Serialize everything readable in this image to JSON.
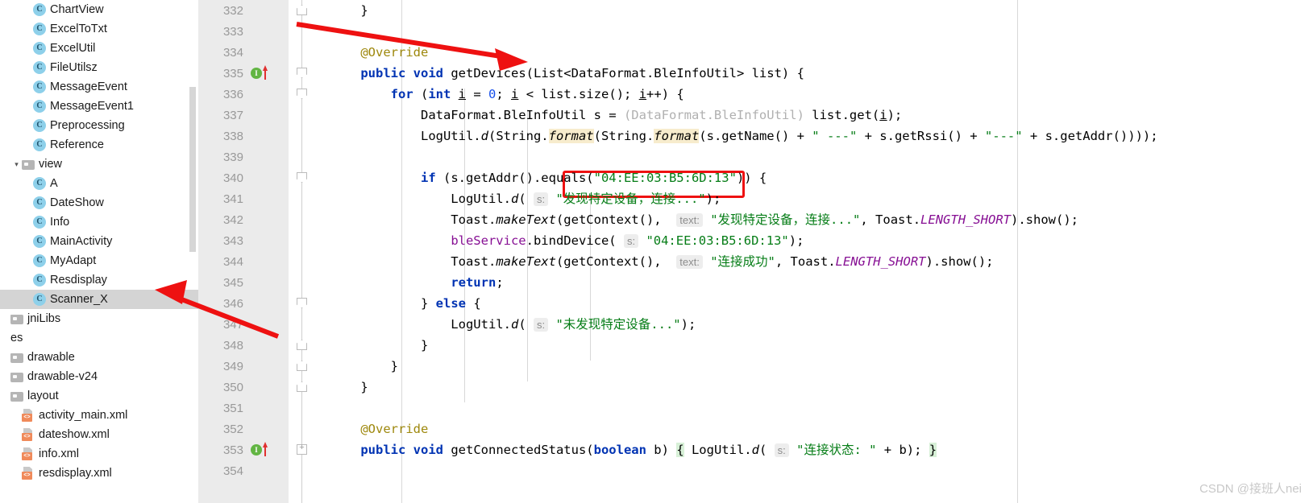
{
  "sidebar": {
    "items": [
      {
        "indent": 2,
        "icon": "java-class-icon",
        "label": "ChartView",
        "selected": false,
        "expander": ""
      },
      {
        "indent": 2,
        "icon": "java-class-icon",
        "label": "ExcelToTxt",
        "selected": false,
        "expander": ""
      },
      {
        "indent": 2,
        "icon": "java-class-icon",
        "label": "ExcelUtil",
        "selected": false,
        "expander": ""
      },
      {
        "indent": 2,
        "icon": "java-class-icon",
        "label": "FileUtilsz",
        "selected": false,
        "expander": ""
      },
      {
        "indent": 2,
        "icon": "java-class-icon",
        "label": "MessageEvent",
        "selected": false,
        "expander": ""
      },
      {
        "indent": 2,
        "icon": "java-class-icon",
        "label": "MessageEvent1",
        "selected": false,
        "expander": ""
      },
      {
        "indent": 2,
        "icon": "java-class-icon",
        "label": "Preprocessing",
        "selected": false,
        "expander": ""
      },
      {
        "indent": 2,
        "icon": "java-class-icon",
        "label": "Reference",
        "selected": false,
        "expander": ""
      },
      {
        "indent": 1,
        "icon": "folder-icon",
        "label": "view",
        "selected": false,
        "expander": "▾"
      },
      {
        "indent": 2,
        "icon": "java-class-icon",
        "label": "A",
        "selected": false,
        "expander": ""
      },
      {
        "indent": 2,
        "icon": "java-class-icon",
        "label": "DateShow",
        "selected": false,
        "expander": ""
      },
      {
        "indent": 2,
        "icon": "java-class-icon",
        "label": "Info",
        "selected": false,
        "expander": ""
      },
      {
        "indent": 2,
        "icon": "java-class-icon",
        "label": "MainActivity",
        "selected": false,
        "expander": ""
      },
      {
        "indent": 2,
        "icon": "java-class-icon",
        "label": "MyAdapt",
        "selected": false,
        "expander": ""
      },
      {
        "indent": 2,
        "icon": "java-class-icon",
        "label": "Resdisplay",
        "selected": false,
        "expander": ""
      },
      {
        "indent": 2,
        "icon": "java-class-icon",
        "label": "Scanner_X",
        "selected": true,
        "expander": ""
      },
      {
        "indent": 0,
        "icon": "folder-icon",
        "label": "jniLibs",
        "selected": false,
        "expander": ""
      },
      {
        "indent": 0,
        "icon": "none",
        "label": "es",
        "selected": false,
        "expander": ""
      },
      {
        "indent": 0,
        "icon": "folder-icon",
        "label": "drawable",
        "selected": false,
        "expander": ""
      },
      {
        "indent": 0,
        "icon": "folder-icon",
        "label": "drawable-v24",
        "selected": false,
        "expander": ""
      },
      {
        "indent": 0,
        "icon": "folder-icon",
        "label": "layout",
        "selected": false,
        "expander": ""
      },
      {
        "indent": 1,
        "icon": "xml-file-icon",
        "label": "activity_main.xml",
        "selected": false,
        "expander": ""
      },
      {
        "indent": 1,
        "icon": "xml-file-icon",
        "label": "dateshow.xml",
        "selected": false,
        "expander": ""
      },
      {
        "indent": 1,
        "icon": "xml-file-icon",
        "label": "info.xml",
        "selected": false,
        "expander": ""
      },
      {
        "indent": 1,
        "icon": "xml-file-icon",
        "label": "resdisplay.xml",
        "selected": false,
        "expander": ""
      }
    ]
  },
  "gutter": {
    "lines": [
      {
        "num": "332",
        "impl": false,
        "fold": "up"
      },
      {
        "num": "333",
        "impl": false,
        "fold": ""
      },
      {
        "num": "334",
        "impl": false,
        "fold": ""
      },
      {
        "num": "335",
        "impl": true,
        "fold": "down"
      },
      {
        "num": "336",
        "impl": false,
        "fold": "down"
      },
      {
        "num": "337",
        "impl": false,
        "fold": ""
      },
      {
        "num": "338",
        "impl": false,
        "fold": ""
      },
      {
        "num": "339",
        "impl": false,
        "fold": ""
      },
      {
        "num": "340",
        "impl": false,
        "fold": "down"
      },
      {
        "num": "341",
        "impl": false,
        "fold": ""
      },
      {
        "num": "342",
        "impl": false,
        "fold": ""
      },
      {
        "num": "343",
        "impl": false,
        "fold": ""
      },
      {
        "num": "344",
        "impl": false,
        "fold": ""
      },
      {
        "num": "345",
        "impl": false,
        "fold": ""
      },
      {
        "num": "346",
        "impl": false,
        "fold": "down"
      },
      {
        "num": "347",
        "impl": false,
        "fold": ""
      },
      {
        "num": "348",
        "impl": false,
        "fold": "up"
      },
      {
        "num": "349",
        "impl": false,
        "fold": "up"
      },
      {
        "num": "350",
        "impl": false,
        "fold": "up"
      },
      {
        "num": "351",
        "impl": false,
        "fold": ""
      },
      {
        "num": "352",
        "impl": false,
        "fold": ""
      },
      {
        "num": "353",
        "impl": true,
        "fold": "plus"
      },
      {
        "num": "354",
        "impl": false,
        "fold": ""
      }
    ]
  },
  "code": {
    "lines": [
      {
        "n": 332,
        "text": "    }"
      },
      {
        "n": 333,
        "text": ""
      },
      {
        "n": 334,
        "text": "    @Override"
      },
      {
        "n": 335,
        "text": "    public void getDevices(List<DataFormat.BleInfoUtil> list) {"
      },
      {
        "n": 336,
        "text": "        for (int i = 0; i < list.size(); i++) {"
      },
      {
        "n": 337,
        "text": "            DataFormat.BleInfoUtil s = (DataFormat.BleInfoUtil) list.get(i);"
      },
      {
        "n": 338,
        "text": "            LogUtil.d(String.format(String.format(s.getName() + \" ---\" + s.getRssi() + \"---\" + s.getAddr())));"
      },
      {
        "n": 339,
        "text": ""
      },
      {
        "n": 340,
        "text": "            if (s.getAddr().equals(\"04:EE:03:B5:6D:13\")) {"
      },
      {
        "n": 341,
        "text": "                LogUtil.d( s: \"发现特定设备，连接...\");"
      },
      {
        "n": 342,
        "text": "                Toast.makeText(getContext(),  text: \"发现特定设备，连接...\", Toast.LENGTH_SHORT).show();"
      },
      {
        "n": 343,
        "text": "                bleService.bindDevice( s: \"04:EE:03:B5:6D:13\");"
      },
      {
        "n": 344,
        "text": "                Toast.makeText(getContext(),  text: \"连接成功\", Toast.LENGTH_SHORT).show();"
      },
      {
        "n": 345,
        "text": "                return;"
      },
      {
        "n": 346,
        "text": "            } else {"
      },
      {
        "n": 347,
        "text": "                LogUtil.d( s: \"未发现特定设备...\");"
      },
      {
        "n": 348,
        "text": "            }"
      },
      {
        "n": 349,
        "text": "        }"
      },
      {
        "n": 350,
        "text": "    }"
      },
      {
        "n": 351,
        "text": ""
      },
      {
        "n": 352,
        "text": "    @Override"
      },
      {
        "n": 353,
        "text": "    public void getConnectedStatus(boolean b) { LogUtil.d( s: \"连接状态: \" + b); }"
      },
      {
        "n": 354,
        "text": ""
      }
    ],
    "tokens": {
      "annotation_override": "@Override",
      "kw_public": "public",
      "kw_void": "void",
      "kw_for": "for",
      "kw_int": "int",
      "kw_if": "if",
      "kw_else": "else",
      "kw_return": "return",
      "kw_boolean": "boolean",
      "method_getDevices": "getDevices",
      "method_getConnectedStatus": "getConnectedStatus",
      "type_list": "List<DataFormat.BleInfoUtil>",
      "param_list": "list",
      "cast_expr": "(DataFormat.BleInfoUtil)",
      "str_mac": "\"04:EE:03:B5:6D:13\"",
      "str_dash_sp": "\" ---\"",
      "str_dash": "\"---\"",
      "str_found_device": "\"发现特定设备，连接...\"",
      "str_connect_ok": "\"连接成功\"",
      "str_not_found": "\"未发现特定设备...\"",
      "str_conn_status": "\"连接状态: \"",
      "static_length_short": "LENGTH_SHORT",
      "field_bleService": "bleService",
      "hint_s": "s:",
      "hint_text": "text:"
    }
  },
  "annotations": {
    "red_box_target": "\"04:EE:03:B5:6D:13\"",
    "arrow_top_label": "points-to-getDevices-method",
    "arrow_bottom_label": "points-to-Scanner_X-file"
  },
  "watermark": {
    "text": "CSDN @接班人nei"
  },
  "colors": {
    "keyword": "#0033b3",
    "string": "#067d17",
    "annotation": "#9e880d",
    "static_field": "#871094",
    "number": "#1750eb",
    "gutter_bg": "#ebebeb",
    "selection": "#d4d4d4",
    "accent_red": "#ee1111",
    "impl_marker_green": "#62b543",
    "class_icon_blue": "#8ed0ea"
  }
}
